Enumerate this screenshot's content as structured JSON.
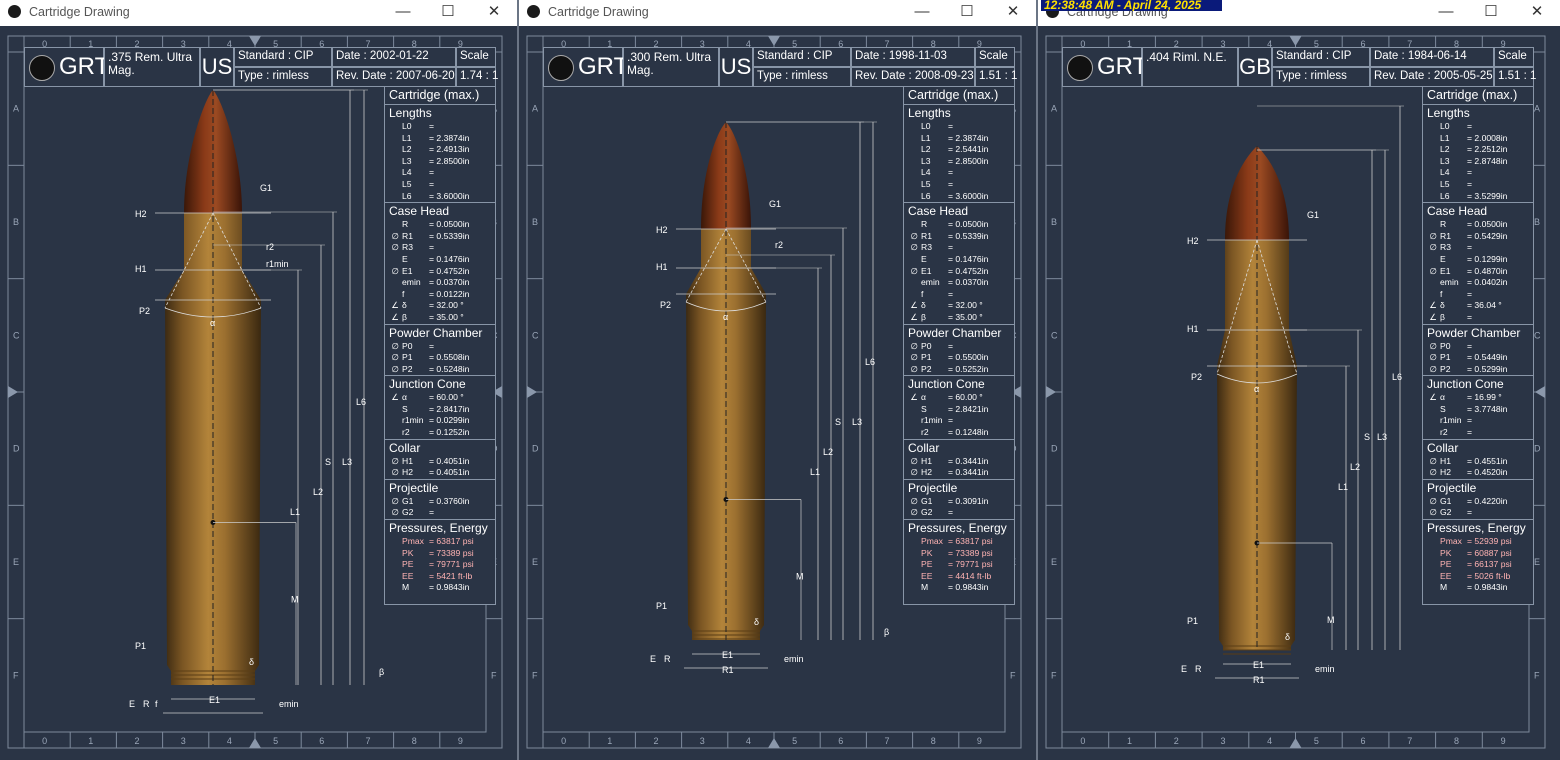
{
  "clock": "12:38:48 AM - April 24, 2025",
  "ruler_numbers": [
    "0",
    "1",
    "2",
    "3",
    "4",
    "5",
    "6",
    "7",
    "8",
    "9"
  ],
  "ruler_letters": [
    "A",
    "B",
    "C",
    "D",
    "E",
    "F"
  ],
  "windows": [
    {
      "title": "Cartridge Drawing",
      "logo": "GRT",
      "name": ".375 Rem. Ultra Mag.",
      "country": "US",
      "standard": "Standard : CIP",
      "type": "Type       : rimless",
      "date": "Date        : 2002-01-22",
      "rev_date": "Rev. Date : 2007-06-20",
      "scale_label": "Scale",
      "scale": "1.74 : 1",
      "table_header": "Cartridge (max.)",
      "sections": [
        {
          "title": "Lengths",
          "rows": [
            [
              "",
              "L0",
              "="
            ],
            [
              "",
              "L1",
              "= 2.3874in"
            ],
            [
              "",
              "L2",
              "= 2.4913in"
            ],
            [
              "",
              "L3",
              "= 2.8500in"
            ],
            [
              "",
              "L4",
              "="
            ],
            [
              "",
              "L5",
              "="
            ],
            [
              "",
              "L6",
              "= 3.6000in"
            ]
          ]
        },
        {
          "title": "Case Head",
          "rows": [
            [
              "",
              "R",
              "= 0.0500in"
            ],
            [
              "∅",
              "R1",
              "= 0.5339in"
            ],
            [
              "∅",
              "R3",
              "="
            ],
            [
              "",
              "E",
              "= 0.1476in"
            ],
            [
              "∅",
              "E1",
              "= 0.4752in"
            ],
            [
              "",
              "emin",
              "= 0.0370in"
            ],
            [
              "",
              "f",
              "= 0.0122in"
            ],
            [
              "∠",
              "δ",
              "= 32.00  °"
            ],
            [
              "∠",
              "β",
              "= 35.00  °"
            ]
          ]
        },
        {
          "title": "Powder Chamber",
          "rows": [
            [
              "∅",
              "P0",
              "="
            ],
            [
              "∅",
              "P1",
              "= 0.5508in"
            ],
            [
              "∅",
              "P2",
              "= 0.5248in"
            ]
          ]
        },
        {
          "title": "Junction Cone",
          "rows": [
            [
              "∠",
              "α",
              "= 60.00  °"
            ],
            [
              "",
              "S",
              "= 2.8417in"
            ],
            [
              "",
              "r1min",
              "= 0.0299in"
            ],
            [
              "",
              "r2",
              "= 0.1252in"
            ]
          ]
        },
        {
          "title": "Collar",
          "rows": [
            [
              "∅",
              "H1",
              "= 0.4051in"
            ],
            [
              "∅",
              "H2",
              "= 0.4051in"
            ]
          ]
        },
        {
          "title": "Projectile",
          "rows": [
            [
              "∅",
              "G1",
              "= 0.3760in"
            ],
            [
              "∅",
              "G2",
              "="
            ]
          ]
        },
        {
          "title": "Pressures, Energy",
          "rows": [
            [
              "",
              "Pmax",
              "= 63817 psi",
              "pink"
            ],
            [
              "",
              "PK",
              "= 73389 psi",
              "pink"
            ],
            [
              "",
              "PE",
              "= 79771 psi",
              "pink"
            ],
            [
              "",
              "EE",
              "= 5421   ft-lb",
              "pink"
            ],
            [
              "",
              "M",
              "= 0.9843in"
            ]
          ]
        }
      ],
      "draw_labels": [
        "H2",
        "G1",
        "H1",
        "r2",
        "r1min",
        "P2",
        "α",
        "P1",
        "δ",
        "β",
        "E",
        "R",
        "f",
        "E1",
        "emin",
        "M",
        "L1",
        "L2",
        "S",
        "L3",
        "L6"
      ]
    },
    {
      "title": "Cartridge Drawing",
      "logo": "GRT",
      "name": ".300 Rem. Ultra Mag.",
      "country": "US",
      "standard": "Standard : CIP",
      "type": "Type       : rimless",
      "date": "Date        : 1998-11-03",
      "rev_date": "Rev. Date : 2008-09-23",
      "scale_label": "Scale",
      "scale": "1.51 : 1",
      "table_header": "Cartridge (max.)",
      "sections": [
        {
          "title": "Lengths",
          "rows": [
            [
              "",
              "L0",
              "="
            ],
            [
              "",
              "L1",
              "= 2.3874in"
            ],
            [
              "",
              "L2",
              "= 2.5441in"
            ],
            [
              "",
              "L3",
              "= 2.8500in"
            ],
            [
              "",
              "L4",
              "="
            ],
            [
              "",
              "L5",
              "="
            ],
            [
              "",
              "L6",
              "= 3.6000in"
            ]
          ]
        },
        {
          "title": "Case Head",
          "rows": [
            [
              "",
              "R",
              "= 0.0500in"
            ],
            [
              "∅",
              "R1",
              "= 0.5339in"
            ],
            [
              "∅",
              "R3",
              "="
            ],
            [
              "",
              "E",
              "= 0.1476in"
            ],
            [
              "∅",
              "E1",
              "= 0.4752in"
            ],
            [
              "",
              "emin",
              "= 0.0370in"
            ],
            [
              "",
              "f",
              "="
            ],
            [
              "∠",
              "δ",
              "= 32.00  °"
            ],
            [
              "∠",
              "β",
              "= 35.00  °"
            ]
          ]
        },
        {
          "title": "Powder Chamber",
          "rows": [
            [
              "∅",
              "P0",
              "="
            ],
            [
              "∅",
              "P1",
              "= 0.5500in"
            ],
            [
              "∅",
              "P2",
              "= 0.5252in"
            ]
          ]
        },
        {
          "title": "Junction Cone",
          "rows": [
            [
              "∠",
              "α",
              "= 60.00  °"
            ],
            [
              "",
              "S",
              "= 2.8421in"
            ],
            [
              "",
              "r1min",
              "="
            ],
            [
              "",
              "r2",
              "= 0.1248in"
            ]
          ]
        },
        {
          "title": "Collar",
          "rows": [
            [
              "∅",
              "H1",
              "= 0.3441in"
            ],
            [
              "∅",
              "H2",
              "= 0.3441in"
            ]
          ]
        },
        {
          "title": "Projectile",
          "rows": [
            [
              "∅",
              "G1",
              "= 0.3091in"
            ],
            [
              "∅",
              "G2",
              "="
            ]
          ]
        },
        {
          "title": "Pressures, Energy",
          "rows": [
            [
              "",
              "Pmax",
              "= 63817 psi",
              "pink"
            ],
            [
              "",
              "PK",
              "= 73389 psi",
              "pink"
            ],
            [
              "",
              "PE",
              "= 79771 psi",
              "pink"
            ],
            [
              "",
              "EE",
              "= 4414   ft-lb",
              "pink"
            ],
            [
              "",
              "M",
              "= 0.9843in"
            ]
          ]
        }
      ],
      "draw_labels": [
        "H2",
        "G1",
        "H1",
        "r2",
        "P2",
        "α",
        "P1",
        "δ",
        "β",
        "E",
        "R",
        "E1",
        "R1",
        "emin",
        "M",
        "L1",
        "L2",
        "S",
        "L3",
        "L6"
      ]
    },
    {
      "title": "Cartridge Drawing",
      "logo": "GRT",
      "name": ".404 Riml. N.E.",
      "country": "GB",
      "standard": "Standard : CIP",
      "type": "Type       : rimless",
      "date": "Date        : 1984-06-14",
      "rev_date": "Rev. Date : 2005-05-25",
      "scale_label": "Scale",
      "scale": "1.51 : 1",
      "table_header": "Cartridge (max.)",
      "sections": [
        {
          "title": "Lengths",
          "rows": [
            [
              "",
              "L0",
              "="
            ],
            [
              "",
              "L1",
              "= 2.0008in"
            ],
            [
              "",
              "L2",
              "= 2.2512in"
            ],
            [
              "",
              "L3",
              "= 2.8748in"
            ],
            [
              "",
              "L4",
              "="
            ],
            [
              "",
              "L5",
              "="
            ],
            [
              "",
              "L6",
              "= 3.5299in"
            ]
          ]
        },
        {
          "title": "Case Head",
          "rows": [
            [
              "",
              "R",
              "= 0.0500in"
            ],
            [
              "∅",
              "R1",
              "= 0.5429in"
            ],
            [
              "∅",
              "R3",
              "="
            ],
            [
              "",
              "E",
              "= 0.1299in"
            ],
            [
              "∅",
              "E1",
              "= 0.4870in"
            ],
            [
              "",
              "emin",
              "= 0.0402in"
            ],
            [
              "",
              "f",
              "="
            ],
            [
              "∠",
              "δ",
              "= 36.04  °"
            ],
            [
              "∠",
              "β",
              "="
            ]
          ]
        },
        {
          "title": "Powder Chamber",
          "rows": [
            [
              "∅",
              "P0",
              "="
            ],
            [
              "∅",
              "P1",
              "= 0.5449in"
            ],
            [
              "∅",
              "P2",
              "= 0.5299in"
            ]
          ]
        },
        {
          "title": "Junction Cone",
          "rows": [
            [
              "∠",
              "α",
              "= 16.99  °"
            ],
            [
              "",
              "S",
              "= 3.7748in"
            ],
            [
              "",
              "r1min",
              "="
            ],
            [
              "",
              "r2",
              "="
            ]
          ]
        },
        {
          "title": "Collar",
          "rows": [
            [
              "∅",
              "H1",
              "= 0.4551in"
            ],
            [
              "∅",
              "H2",
              "= 0.4520in"
            ]
          ]
        },
        {
          "title": "Projectile",
          "rows": [
            [
              "∅",
              "G1",
              "= 0.4220in"
            ],
            [
              "∅",
              "G2",
              "="
            ]
          ]
        },
        {
          "title": "Pressures, Energy",
          "rows": [
            [
              "",
              "Pmax",
              "= 52939 psi",
              "pink"
            ],
            [
              "",
              "PK",
              "= 60887 psi",
              "pink"
            ],
            [
              "",
              "PE",
              "= 66137 psi",
              "pink"
            ],
            [
              "",
              "EE",
              "= 5026   ft-lb",
              "pink"
            ],
            [
              "",
              "M",
              "= 0.9843in"
            ]
          ]
        }
      ],
      "draw_labels": [
        "H2",
        "G1",
        "H1",
        "P2",
        "α",
        "P1",
        "δ",
        "E",
        "R",
        "E1",
        "R1",
        "emin",
        "M",
        "L1",
        "L2",
        "L3",
        "L6",
        "S"
      ]
    }
  ]
}
